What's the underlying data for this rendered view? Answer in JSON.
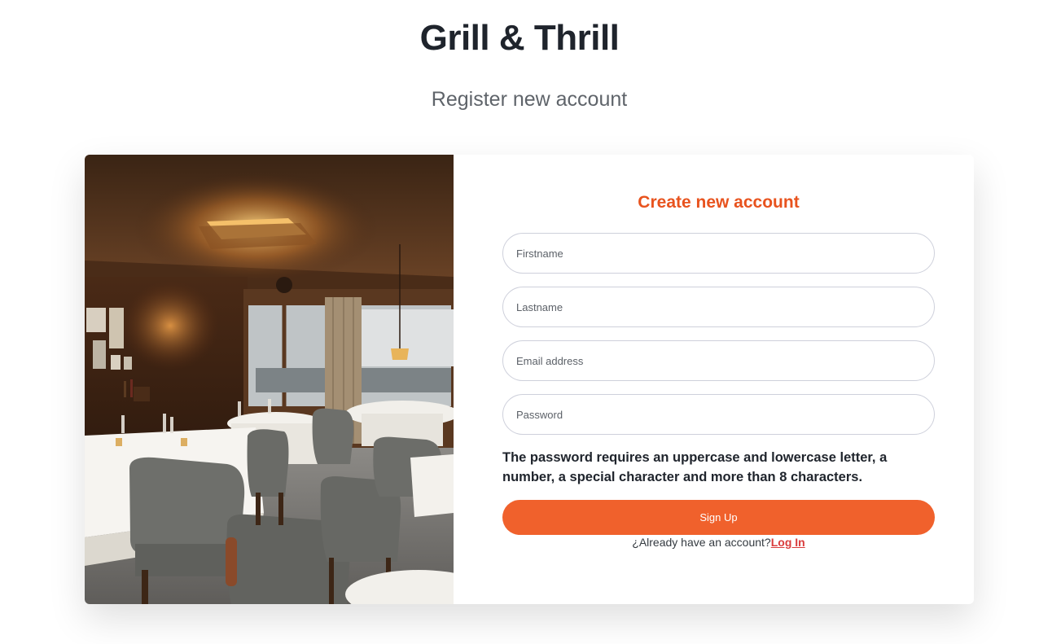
{
  "header": {
    "brand": "Grill & Thrill",
    "subtitle": "Register new account"
  },
  "photo": {
    "description_icon": "restaurant-photo"
  },
  "form": {
    "title": "Create new account",
    "firstname_placeholder": "Firstname",
    "lastname_placeholder": "Lastname",
    "email_placeholder": "Email address",
    "password_placeholder": "Password",
    "password_hint": "The password requires an uppercase and lowercase letter, a number, a special character and more than 8 characters.",
    "signup_label": "Sign Up",
    "login_prompt": "¿Already have an account?",
    "login_link": "Log In"
  },
  "colors": {
    "accent": "#f0612c",
    "title": "#e8531e",
    "link": "#d93c3c"
  }
}
